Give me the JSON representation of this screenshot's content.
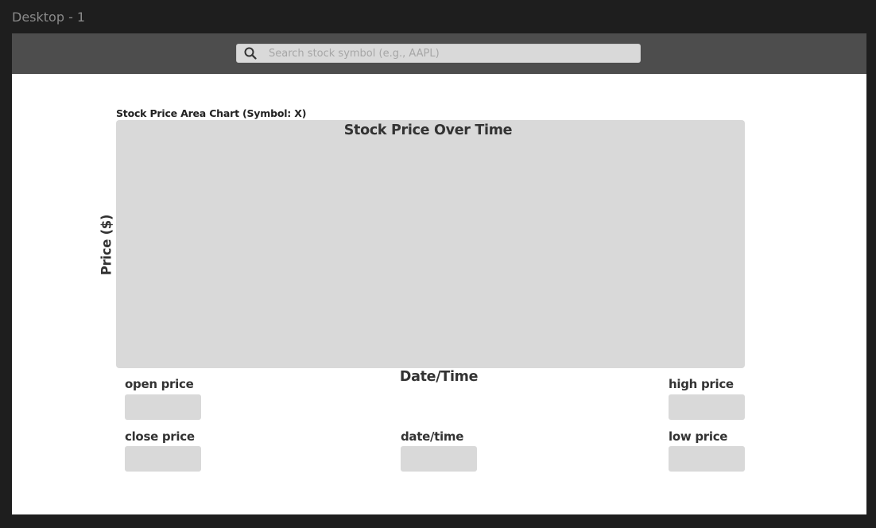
{
  "window": {
    "frame_title": "Desktop - 1"
  },
  "search": {
    "placeholder": "Search stock symbol (e.g., AAPL)",
    "value": ""
  },
  "chart": {
    "caption": "Stock Price Area Chart (Symbol: X)",
    "title": "Stock Price Over Time",
    "y_label": "Price ($)",
    "x_label": "Date/Time"
  },
  "fields": {
    "open_price": {
      "label": "open price",
      "value": ""
    },
    "high_price": {
      "label": "high price",
      "value": ""
    },
    "close_price": {
      "label": "close price",
      "value": ""
    },
    "date_time": {
      "label": "date/time",
      "value": ""
    },
    "low_price": {
      "label": "low price",
      "value": ""
    }
  },
  "icons": {
    "search": "search-icon"
  },
  "colors": {
    "background": "#1e1e1e",
    "topbar": "#4d4d4d",
    "placeholder_fill": "#d9d9d9",
    "text": "#333333"
  }
}
